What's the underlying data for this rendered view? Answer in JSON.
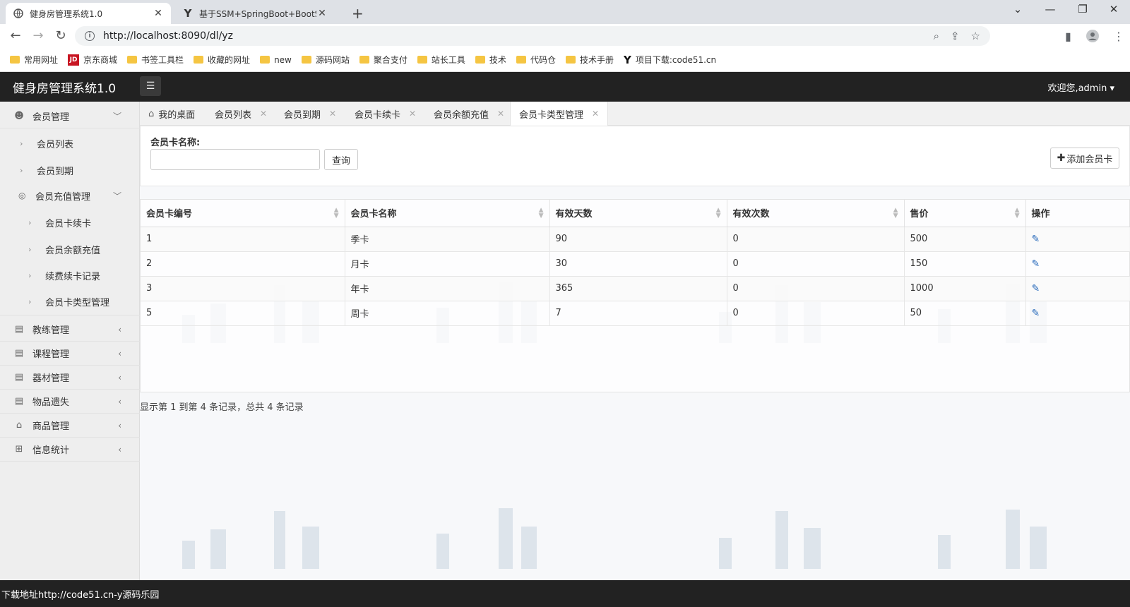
{
  "browser": {
    "tabs": [
      {
        "title": "健身房管理系统1.0",
        "close": "✕"
      },
      {
        "title": "基于SSM+SpringBoot+BootSt",
        "close": "✕"
      }
    ],
    "new_tab": "+",
    "url": "http://localhost:8090/dl/yz",
    "bookmarks": [
      "常用网址",
      "京东商城",
      "书签工具栏",
      "收藏的网址",
      "new",
      "源码网站",
      "聚合支付",
      "站长工具",
      "技术",
      "代码仓",
      "技术手册",
      "项目下载:code51.cn"
    ]
  },
  "app": {
    "title": "健身房管理系统1.0",
    "welcome": "欢迎您,admin"
  },
  "sidebar": {
    "member_mgmt": "会员管理",
    "member_list": "会员列表",
    "member_expire": "会员到期",
    "recharge_mgmt": "会员充值管理",
    "card_renew": "会员卡续卡",
    "balance_recharge": "会员余额充值",
    "renew_records": "续费续卡记录",
    "card_type_mgmt": "会员卡类型管理",
    "coach_mgmt": "教练管理",
    "course_mgmt": "课程管理",
    "equipment_mgmt": "器材管理",
    "lost_items": "物品遗失",
    "goods_mgmt": "商品管理",
    "statistics": "信息统计"
  },
  "page_tabs": {
    "desktop": "我的桌面",
    "member_list": "会员列表",
    "member_expire": "会员到期",
    "card_renew": "会员卡续卡",
    "balance_recharge": "会员余额充值",
    "card_type_mgmt": "会员卡类型管理"
  },
  "search": {
    "label": "会员卡名称:",
    "value": "",
    "query_button": "查询",
    "add_button": "添加会员卡"
  },
  "table": {
    "headers": [
      "会员卡编号",
      "会员卡名称",
      "有效天数",
      "有效次数",
      "售价",
      "操作"
    ],
    "rows": [
      {
        "id": "1",
        "name": "季卡",
        "days": "90",
        "times": "0",
        "price": "500"
      },
      {
        "id": "2",
        "name": "月卡",
        "days": "30",
        "times": "0",
        "price": "150"
      },
      {
        "id": "3",
        "name": "年卡",
        "days": "365",
        "times": "0",
        "price": "1000"
      },
      {
        "id": "5",
        "name": "周卡",
        "days": "7",
        "times": "0",
        "price": "50"
      }
    ]
  },
  "pagination_info": "显示第 1 到第 4 条记录，总共 4 条记录",
  "footer": "下载地址http://code51.cn-y源码乐园"
}
